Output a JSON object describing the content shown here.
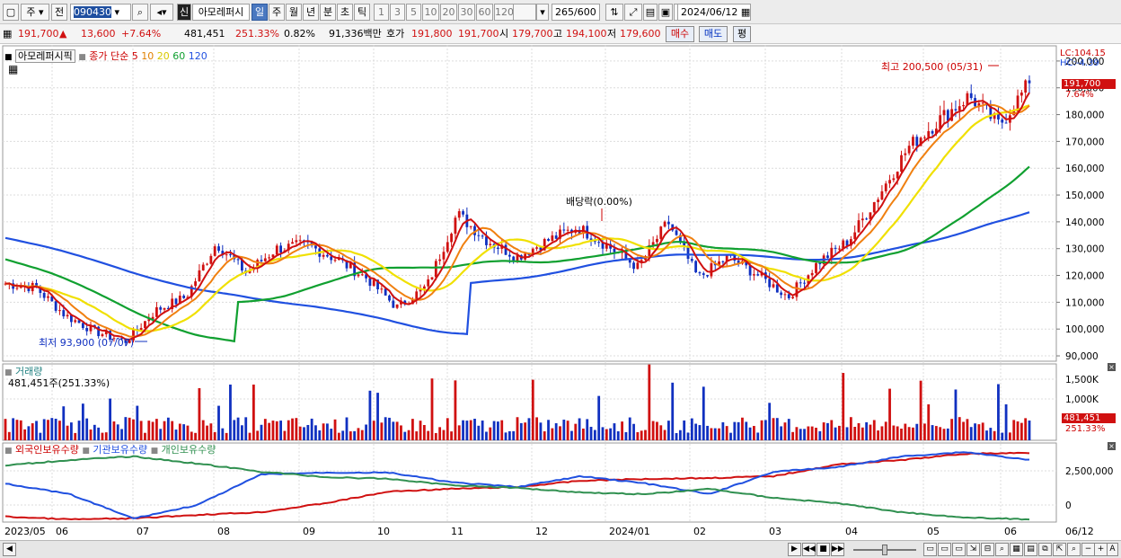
{
  "toolbar": {
    "period_type": "주",
    "prev_label": "전",
    "code": "090430",
    "stock_name": "아모레퍼시",
    "badge_sin": "신",
    "periods": [
      "일",
      "주",
      "월",
      "년",
      "분",
      "초",
      "틱"
    ],
    "active_period": "일",
    "intervals": [
      "1",
      "3",
      "5",
      "10",
      "20",
      "30",
      "60",
      "120"
    ],
    "count": "265",
    "count_total": "/600",
    "date": "2024/06/12"
  },
  "info": {
    "price": "191,700",
    "change_arrow": "▲",
    "change": "13,600",
    "change_pct": "+7.64%",
    "volume": "481,451",
    "volume_ratio": "251.33%",
    "turnover": "0.82%",
    "amount": "91,336백만",
    "quote_label": "호가",
    "ask": "191,800",
    "bid": "191,700",
    "open_label": "시",
    "open": "179,700",
    "high_label": "고",
    "high": "194,100",
    "low_label": "저",
    "low": "179,600",
    "buy_label": "매수",
    "sell_label": "매도",
    "avg_label": "평"
  },
  "price_panel": {
    "stock_label": "아모레퍼시픽",
    "ma_label": "종가 단순",
    "ma_periods": [
      "5",
      "10",
      "20",
      "60",
      "120"
    ],
    "lc": "LC:104.15",
    "hc": "HC:-4.39",
    "high_annotation": "최고 200,500 (05/31)",
    "low_annotation": "최저 93,900 (07/07)",
    "dividend_annotation": "배당락(0.00%)",
    "current_price_label": "191,700",
    "current_pct_label": "7.64%"
  },
  "volume_panel": {
    "title": "거래량",
    "value_label": "481,451주(251.33%)",
    "current_label": "481,451",
    "current_pct": "251.33%"
  },
  "holdings_panel": {
    "legend": [
      "외국인보유수량",
      "기관보유수량",
      "개인보유수량"
    ]
  },
  "chart_data": {
    "type": "candlestick",
    "colors": {
      "up": "#d01010",
      "down": "#1030c0",
      "ma5": "#d01010",
      "ma10": "#f08010",
      "ma20": "#f0e000",
      "ma60": "#10a030",
      "ma120": "#2050e0",
      "foreign": "#d01010",
      "institution": "#2050e0",
      "individual": "#309050"
    },
    "x_labels": [
      "2023/05",
      "06",
      "07",
      "08",
      "09",
      "10",
      "11",
      "12",
      "2024/01",
      "02",
      "03",
      "04",
      "05",
      "06",
      "06/12"
    ],
    "price_axis": {
      "ticks": [
        "200,000",
        "190,000",
        "180,000",
        "170,000",
        "160,000",
        "150,000",
        "140,000",
        "130,000",
        "120,000",
        "110,000",
        "100,000",
        "90,000"
      ],
      "ylim": [
        88000,
        206000
      ]
    },
    "volume_axis": {
      "ticks": [
        "1,500K",
        "1,000K"
      ]
    },
    "holdings_axis": {
      "ticks": [
        "2,500,000",
        "0"
      ]
    },
    "close_series": [
      {
        "date": "2023-05",
        "close": 117000
      },
      {
        "date": "2023-06-01",
        "close": 115500
      },
      {
        "date": "2023-06-15",
        "close": 105000
      },
      {
        "date": "2023-06-30",
        "close": 99000
      },
      {
        "date": "2023-07-07",
        "close": 95500
      },
      {
        "date": "2023-07-20",
        "close": 107000
      },
      {
        "date": "2023-07-31",
        "close": 112000
      },
      {
        "date": "2023-08-07",
        "close": 132000
      },
      {
        "date": "2023-08-20",
        "close": 121000
      },
      {
        "date": "2023-08-31",
        "close": 130000
      },
      {
        "date": "2023-09-10",
        "close": 131500
      },
      {
        "date": "2023-09-25",
        "close": 126000
      },
      {
        "date": "2023-10-10",
        "close": 119000
      },
      {
        "date": "2023-10-25",
        "close": 108000
      },
      {
        "date": "2023-11-01",
        "close": 116000
      },
      {
        "date": "2023-11-07",
        "close": 143000
      },
      {
        "date": "2023-11-20",
        "close": 133000
      },
      {
        "date": "2023-12-05",
        "close": 127000
      },
      {
        "date": "2023-12-20",
        "close": 133000
      },
      {
        "date": "2023-12-27",
        "close": 138000
      },
      {
        "date": "2024-01-10",
        "close": 131000
      },
      {
        "date": "2024-01-25",
        "close": 123000
      },
      {
        "date": "2024-02-01",
        "close": 140000
      },
      {
        "date": "2024-02-07",
        "close": 119000
      },
      {
        "date": "2024-02-20",
        "close": 127000
      },
      {
        "date": "2024-03-05",
        "close": 120000
      },
      {
        "date": "2024-03-20",
        "close": 112000
      },
      {
        "date": "2024-04-05",
        "close": 125000
      },
      {
        "date": "2024-04-20",
        "close": 133000
      },
      {
        "date": "2024-05-01",
        "close": 150000
      },
      {
        "date": "2024-05-10",
        "close": 168000
      },
      {
        "date": "2024-05-20",
        "close": 178000
      },
      {
        "date": "2024-05-31",
        "close": 187000
      },
      {
        "date": "2024-06-05",
        "close": 176000
      },
      {
        "date": "2024-06-12",
        "close": 191700
      }
    ]
  }
}
